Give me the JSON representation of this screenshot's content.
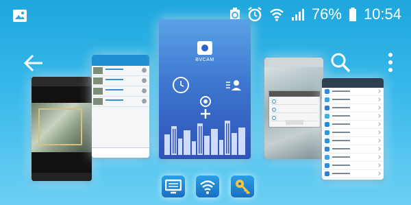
{
  "status": {
    "battery": "76%",
    "time": "10:54"
  },
  "app": {
    "name": "BVCAM"
  },
  "icons": {
    "gallery": "gallery-icon",
    "sync": "sync-icon",
    "alarm": "alarm-icon",
    "wifi": "wifi-icon",
    "signal": "signal-icon",
    "battery": "battery-icon",
    "back": "back-arrow-icon",
    "search": "search-icon",
    "more": "more-vert-icon"
  },
  "dock": [
    "monitor-icon",
    "wifi-icon",
    "key-icon"
  ],
  "colors": {
    "background": "#2aaee6",
    "accent": "#1a6fc2"
  }
}
